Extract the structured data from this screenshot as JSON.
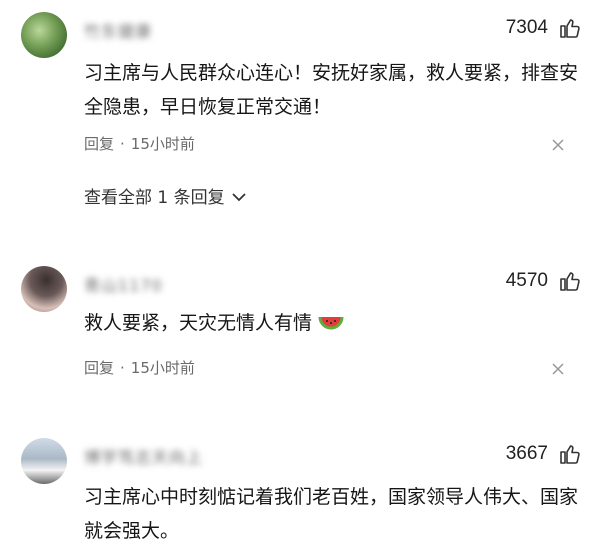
{
  "comments": [
    {
      "username": "竹东健康",
      "likes": "7304",
      "text": "习主席与人民群众心连心！安抚好家属，救人要紧，排查安全隐患，早日恢复正常交通！",
      "reply_label": "回复",
      "time": "15小时前",
      "view_all": "查看全部 1 条回复"
    },
    {
      "username": "青山1170",
      "likes": "4570",
      "text": "救人要紧，天灾无情人有情",
      "emoji": "watermelon",
      "reply_label": "回复",
      "time": "15小时前"
    },
    {
      "username": "博学笃志天向上",
      "likes": "3667",
      "text": "习主席心中时刻惦记着我们老百姓，国家领导人伟大、国家就会强大。"
    }
  ],
  "icons": {
    "like": "thumb-up-icon",
    "close": "close-icon",
    "chevron": "chevron-down-icon"
  }
}
